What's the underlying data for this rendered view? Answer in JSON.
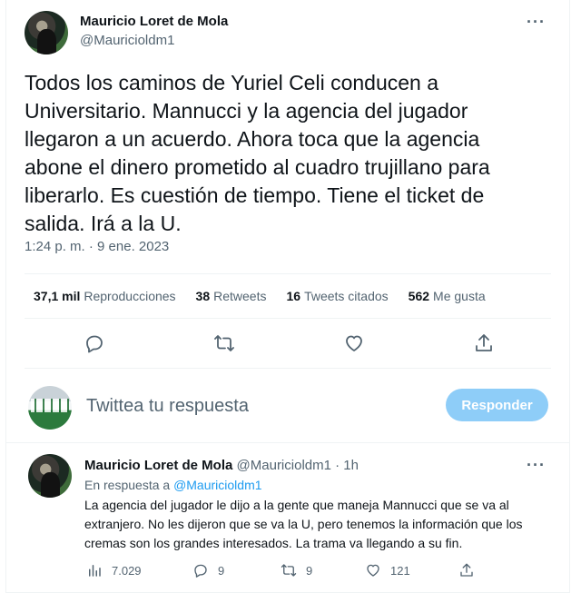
{
  "tweet": {
    "author_name": "Mauricio Loret de Mola",
    "author_handle": "@Mauricioldm1",
    "more_label": "···",
    "text": "Todos los caminos de Yuriel Celi conducen a Universitario. Mannucci y la agencia del jugador llegaron a un acuerdo. Ahora toca que la agencia abone el dinero prometido al cuadro trujillano para liberarlo. Es cuestión de tiempo. Tiene el ticket de salida. Irá a la U.",
    "timestamp": "1:24 p. m. · 9 ene. 2023",
    "stats": [
      {
        "value": "37,1 mil",
        "label": "Reproducciones"
      },
      {
        "value": "38",
        "label": "Retweets"
      },
      {
        "value": "16",
        "label": "Tweets citados"
      },
      {
        "value": "562",
        "label": "Me gusta"
      }
    ],
    "actions": [
      "reply-icon",
      "retweet-icon",
      "like-icon",
      "share-icon"
    ]
  },
  "composer": {
    "placeholder": "Twittea tu respuesta",
    "button_label": "Responder"
  },
  "reply": {
    "author_name": "Mauricio Loret de Mola",
    "author_handle": "@Mauricioldm1",
    "time": "1h",
    "more_label": "···",
    "in_reply_prefix": "En respuesta a",
    "in_reply_handle": "@Mauricioldm1",
    "text": "La agencia del jugador le dijo a la gente que maneja Mannucci que se va al extranjero. No les dijeron que se va la U, pero tenemos la información que los cremas son los grandes interesados. La trama va llegando a su fin.",
    "metrics": {
      "views": "7.029",
      "replies": "9",
      "retweets": "9",
      "likes": "121"
    }
  },
  "colors": {
    "accent": "#1d9bf0",
    "button_disabled": "#8ecdf8",
    "secondary_text": "#536471"
  }
}
